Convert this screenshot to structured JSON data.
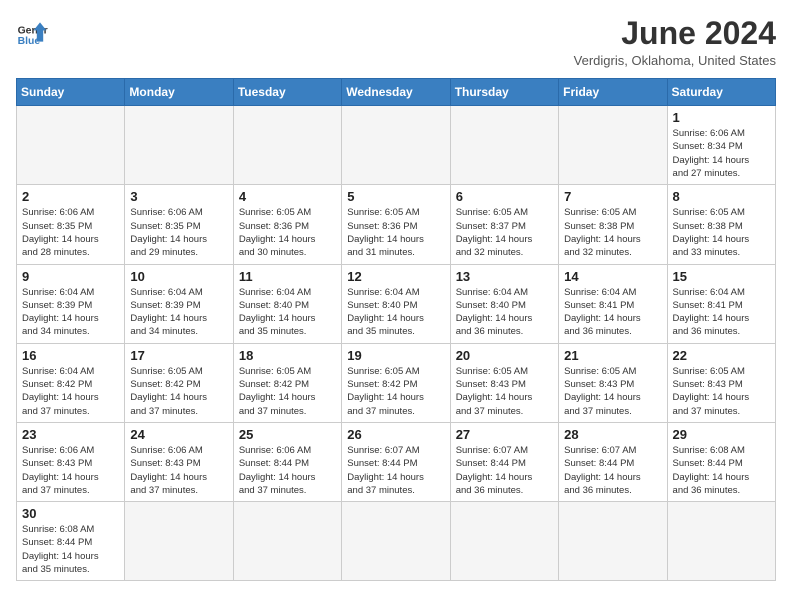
{
  "header": {
    "logo_general": "General",
    "logo_blue": "Blue",
    "month": "June 2024",
    "location": "Verdigris, Oklahoma, United States"
  },
  "weekdays": [
    "Sunday",
    "Monday",
    "Tuesday",
    "Wednesday",
    "Thursday",
    "Friday",
    "Saturday"
  ],
  "weeks": [
    [
      {
        "day": "",
        "info": ""
      },
      {
        "day": "",
        "info": ""
      },
      {
        "day": "",
        "info": ""
      },
      {
        "day": "",
        "info": ""
      },
      {
        "day": "",
        "info": ""
      },
      {
        "day": "",
        "info": ""
      },
      {
        "day": "1",
        "info": "Sunrise: 6:06 AM\nSunset: 8:34 PM\nDaylight: 14 hours\nand 27 minutes."
      }
    ],
    [
      {
        "day": "2",
        "info": "Sunrise: 6:06 AM\nSunset: 8:35 PM\nDaylight: 14 hours\nand 28 minutes."
      },
      {
        "day": "3",
        "info": "Sunrise: 6:06 AM\nSunset: 8:35 PM\nDaylight: 14 hours\nand 29 minutes."
      },
      {
        "day": "4",
        "info": "Sunrise: 6:05 AM\nSunset: 8:36 PM\nDaylight: 14 hours\nand 30 minutes."
      },
      {
        "day": "5",
        "info": "Sunrise: 6:05 AM\nSunset: 8:36 PM\nDaylight: 14 hours\nand 31 minutes."
      },
      {
        "day": "6",
        "info": "Sunrise: 6:05 AM\nSunset: 8:37 PM\nDaylight: 14 hours\nand 32 minutes."
      },
      {
        "day": "7",
        "info": "Sunrise: 6:05 AM\nSunset: 8:38 PM\nDaylight: 14 hours\nand 32 minutes."
      },
      {
        "day": "8",
        "info": "Sunrise: 6:05 AM\nSunset: 8:38 PM\nDaylight: 14 hours\nand 33 minutes."
      }
    ],
    [
      {
        "day": "9",
        "info": "Sunrise: 6:04 AM\nSunset: 8:39 PM\nDaylight: 14 hours\nand 34 minutes."
      },
      {
        "day": "10",
        "info": "Sunrise: 6:04 AM\nSunset: 8:39 PM\nDaylight: 14 hours\nand 34 minutes."
      },
      {
        "day": "11",
        "info": "Sunrise: 6:04 AM\nSunset: 8:40 PM\nDaylight: 14 hours\nand 35 minutes."
      },
      {
        "day": "12",
        "info": "Sunrise: 6:04 AM\nSunset: 8:40 PM\nDaylight: 14 hours\nand 35 minutes."
      },
      {
        "day": "13",
        "info": "Sunrise: 6:04 AM\nSunset: 8:40 PM\nDaylight: 14 hours\nand 36 minutes."
      },
      {
        "day": "14",
        "info": "Sunrise: 6:04 AM\nSunset: 8:41 PM\nDaylight: 14 hours\nand 36 minutes."
      },
      {
        "day": "15",
        "info": "Sunrise: 6:04 AM\nSunset: 8:41 PM\nDaylight: 14 hours\nand 36 minutes."
      }
    ],
    [
      {
        "day": "16",
        "info": "Sunrise: 6:04 AM\nSunset: 8:42 PM\nDaylight: 14 hours\nand 37 minutes."
      },
      {
        "day": "17",
        "info": "Sunrise: 6:05 AM\nSunset: 8:42 PM\nDaylight: 14 hours\nand 37 minutes."
      },
      {
        "day": "18",
        "info": "Sunrise: 6:05 AM\nSunset: 8:42 PM\nDaylight: 14 hours\nand 37 minutes."
      },
      {
        "day": "19",
        "info": "Sunrise: 6:05 AM\nSunset: 8:42 PM\nDaylight: 14 hours\nand 37 minutes."
      },
      {
        "day": "20",
        "info": "Sunrise: 6:05 AM\nSunset: 8:43 PM\nDaylight: 14 hours\nand 37 minutes."
      },
      {
        "day": "21",
        "info": "Sunrise: 6:05 AM\nSunset: 8:43 PM\nDaylight: 14 hours\nand 37 minutes."
      },
      {
        "day": "22",
        "info": "Sunrise: 6:05 AM\nSunset: 8:43 PM\nDaylight: 14 hours\nand 37 minutes."
      }
    ],
    [
      {
        "day": "23",
        "info": "Sunrise: 6:06 AM\nSunset: 8:43 PM\nDaylight: 14 hours\nand 37 minutes."
      },
      {
        "day": "24",
        "info": "Sunrise: 6:06 AM\nSunset: 8:43 PM\nDaylight: 14 hours\nand 37 minutes."
      },
      {
        "day": "25",
        "info": "Sunrise: 6:06 AM\nSunset: 8:44 PM\nDaylight: 14 hours\nand 37 minutes."
      },
      {
        "day": "26",
        "info": "Sunrise: 6:07 AM\nSunset: 8:44 PM\nDaylight: 14 hours\nand 37 minutes."
      },
      {
        "day": "27",
        "info": "Sunrise: 6:07 AM\nSunset: 8:44 PM\nDaylight: 14 hours\nand 36 minutes."
      },
      {
        "day": "28",
        "info": "Sunrise: 6:07 AM\nSunset: 8:44 PM\nDaylight: 14 hours\nand 36 minutes."
      },
      {
        "day": "29",
        "info": "Sunrise: 6:08 AM\nSunset: 8:44 PM\nDaylight: 14 hours\nand 36 minutes."
      }
    ],
    [
      {
        "day": "30",
        "info": "Sunrise: 6:08 AM\nSunset: 8:44 PM\nDaylight: 14 hours\nand 35 minutes."
      },
      {
        "day": "",
        "info": ""
      },
      {
        "day": "",
        "info": ""
      },
      {
        "day": "",
        "info": ""
      },
      {
        "day": "",
        "info": ""
      },
      {
        "day": "",
        "info": ""
      },
      {
        "day": "",
        "info": ""
      }
    ]
  ]
}
